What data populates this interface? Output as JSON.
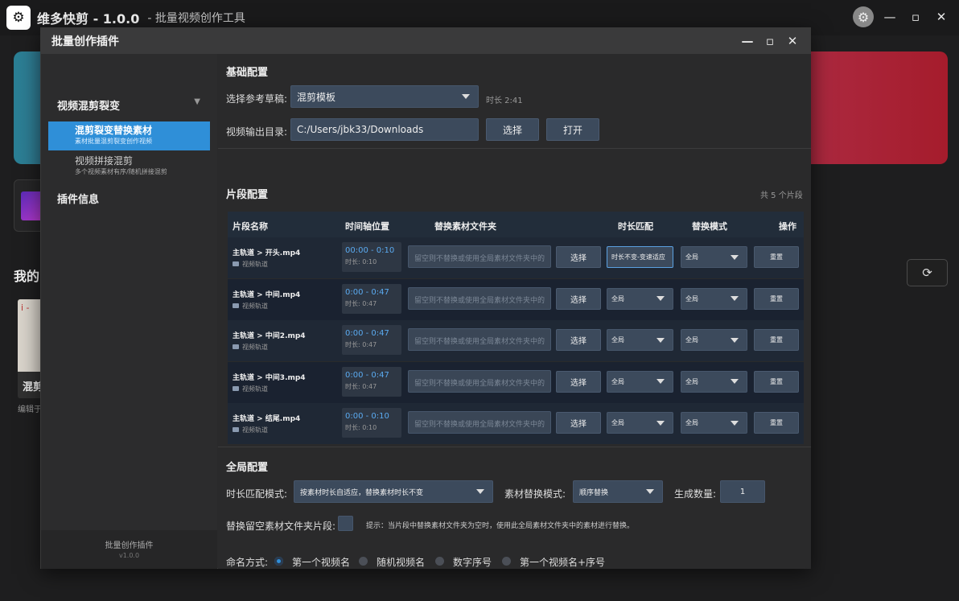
{
  "app": {
    "logo_glyph": "⚙",
    "title": "维多快剪 - 1.0.0",
    "subtitle": "- 批量视频创作工具",
    "controls": {
      "minimize": "—",
      "maximize": "▫",
      "close": "✕"
    }
  },
  "background": {
    "section_title": "我的",
    "project_label": "混剪",
    "project_edit": "编辑于",
    "project_thumb_text": "i -"
  },
  "dialog": {
    "title": "批量创作插件",
    "controls": {
      "minimize": "—",
      "maximize": "▫",
      "close": "✕"
    }
  },
  "sidebar": {
    "group_label": "视频混剪裂变",
    "items": [
      {
        "title": "混剪裂变替换素材",
        "desc": "素材批量混剪裂变创作视频"
      },
      {
        "title": "视频拼接混剪",
        "desc": "多个视频素材有序/随机拼接混剪"
      }
    ],
    "info_label": "插件信息",
    "footer_name": "批量创作插件",
    "footer_version": "v1.0.0"
  },
  "basic": {
    "title": "基础配置",
    "ref_label": "选择参考草稿:",
    "ref_value": "混剪模板",
    "duration_text": "时长 2:41",
    "output_label": "视频输出目录:",
    "output_value": "C:/Users/jbk33/Downloads",
    "choose_btn": "选择",
    "open_btn": "打开"
  },
  "segments": {
    "title": "片段配置",
    "count_text": "共 5 个片段",
    "headers": [
      "片段名称",
      "时间轴位置",
      "替换素材文件夹",
      "时长匹配",
      "替换模式",
      "操作"
    ],
    "folder_placeholder": "留空则不替换或使用全局素材文件夹中的",
    "choose_label": "选择",
    "reset_label": "重置",
    "rows": [
      {
        "name": "主轨道 > 开头.mp4",
        "track": "视频轨道",
        "range": "00:00 - 0:10",
        "duration": "时长: 0:10",
        "match": "时长不变-变速适应",
        "mode": "全局"
      },
      {
        "name": "主轨道 > 中间.mp4",
        "track": "视频轨道",
        "range": "0:00 - 0:47",
        "duration": "时长: 0:47",
        "match": "全局",
        "mode": "全局"
      },
      {
        "name": "主轨道 > 中间2.mp4",
        "track": "视频轨道",
        "range": "0:00 - 0:47",
        "duration": "时长: 0:47",
        "match": "全局",
        "mode": "全局"
      },
      {
        "name": "主轨道 > 中间3.mp4",
        "track": "视频轨道",
        "range": "0:00 - 0:47",
        "duration": "时长: 0:47",
        "match": "全局",
        "mode": "全局"
      },
      {
        "name": "主轨道 > 结尾.mp4",
        "track": "视频轨道",
        "range": "0:00 - 0:10",
        "duration": "时长: 0:10",
        "match": "全局",
        "mode": "全局"
      }
    ]
  },
  "global": {
    "title": "全局配置",
    "match_label": "时长匹配模式:",
    "match_value": "按素材时长自适应，替换素材时长不变",
    "replace_label": "素材替换模式:",
    "replace_value": "顺序替换",
    "count_label": "生成数量:",
    "count_value": "1",
    "empty_label": "替换留空素材文件夹片段:",
    "hint": "提示：当片段中替换素材文件夹为空时，使用此全局素材文件夹中的素材进行替换。",
    "naming_label": "命名方式:",
    "naming_options": [
      "第一个视频名",
      "随机视频名",
      "数字序号",
      "第一个视频名+序号"
    ],
    "naming_selected": 0
  }
}
